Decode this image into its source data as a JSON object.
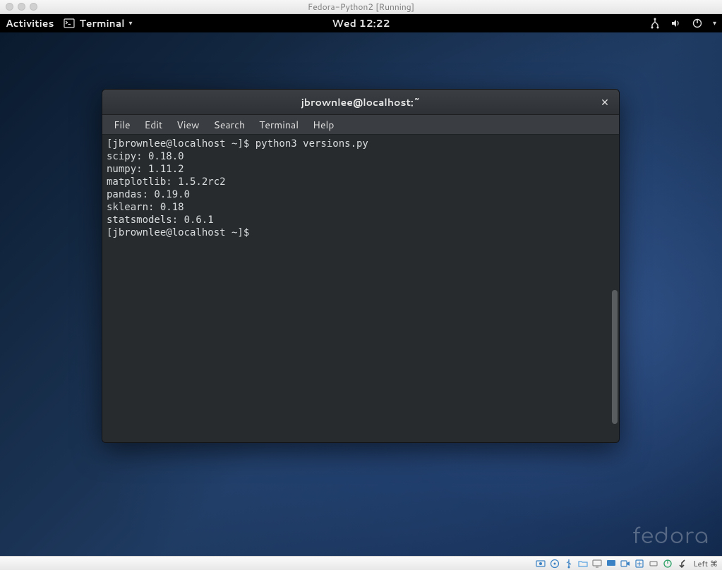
{
  "host": {
    "title": "Fedora-Python2 [Running]",
    "status_indicator_text": "Left ⌘"
  },
  "panel": {
    "activities": "Activities",
    "app_label": "Terminal",
    "clock": "Wed 12:22"
  },
  "desktop": {
    "watermark": "fedora"
  },
  "terminal": {
    "title": "jbrownlee@localhost:~",
    "menus": {
      "file": "File",
      "edit": "Edit",
      "view": "View",
      "search": "Search",
      "terminal": "Terminal",
      "help": "Help"
    },
    "lines": [
      "[jbrownlee@localhost ~]$ python3 versions.py",
      "scipy: 0.18.0",
      "numpy: 1.11.2",
      "matplotlib: 1.5.2rc2",
      "pandas: 0.19.0",
      "sklearn: 0.18",
      "statsmodels: 0.6.1",
      "[jbrownlee@localhost ~]$ "
    ]
  }
}
